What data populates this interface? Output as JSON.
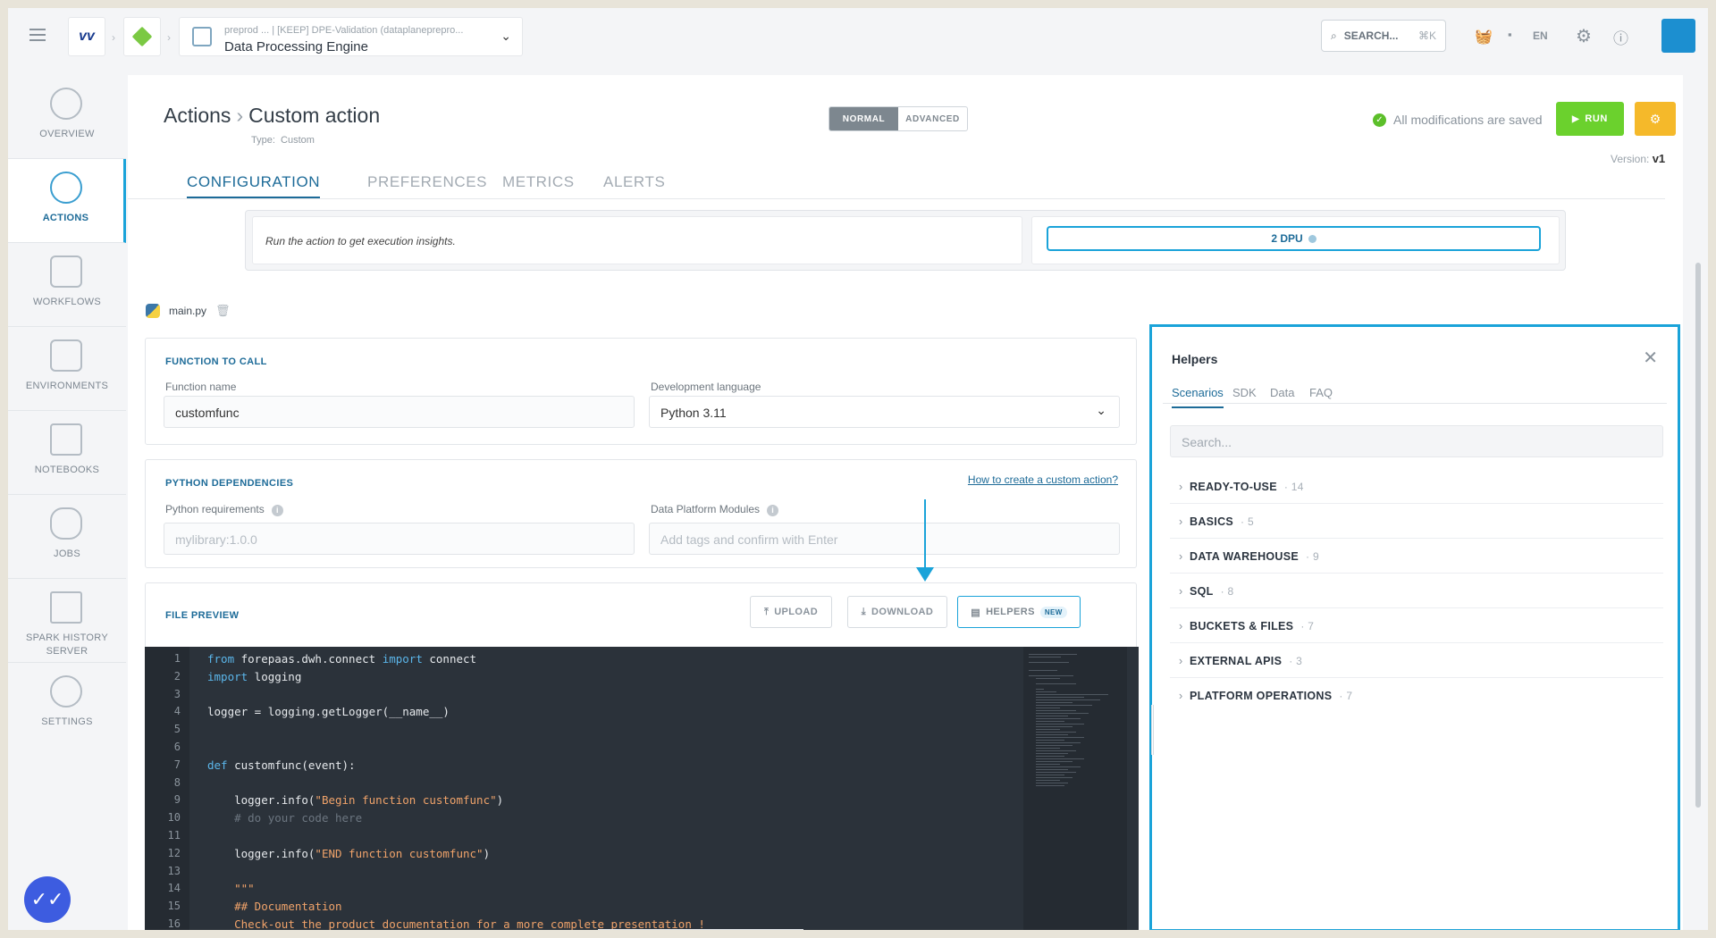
{
  "topbar": {
    "project_subtitle": "preprod ...   | [KEEP] DPE-Validation (dataplanepreprо...",
    "project_title": "Data Processing Engine",
    "search_label": "SEARCH...",
    "search_shortcut": "⌘K",
    "language": "EN"
  },
  "sidebar": {
    "items": [
      {
        "label": "OVERVIEW",
        "icon": "overview-icon"
      },
      {
        "label": "ACTIONS",
        "icon": "actions-icon"
      },
      {
        "label": "WORKFLOWS",
        "icon": "workflows-icon"
      },
      {
        "label": "ENVIRONMENTS",
        "icon": "environments-icon"
      },
      {
        "label": "NOTEBOOKS",
        "icon": "notebooks-icon"
      },
      {
        "label": "JOBS",
        "icon": "jobs-icon"
      },
      {
        "label": "SPARK HISTORY SERVER",
        "icon": "spark-history-icon"
      },
      {
        "label": "SETTINGS",
        "icon": "settings-icon"
      }
    ]
  },
  "header": {
    "breadcrumb_parent": "Actions",
    "breadcrumb_current": "Custom action",
    "type_label": "Type:",
    "type_value": "Custom",
    "mode_normal": "NORMAL",
    "mode_advanced": "ADVANCED",
    "saved_status": "All modifications are saved",
    "run_label": "RUN",
    "version_label": "Version:",
    "version_value": "v1"
  },
  "tabs": [
    "CONFIGURATION",
    "PREFERENCES",
    "METRICS",
    "ALERTS"
  ],
  "insight": {
    "message": "Run the action to get execution insights.",
    "dpu": "2 DPU"
  },
  "file": {
    "name": "main.py"
  },
  "function_card": {
    "title": "FUNCTION TO CALL",
    "function_name_label": "Function name",
    "function_name_value": "customfunc",
    "language_label": "Development language",
    "language_value": "Python 3.11"
  },
  "deps_card": {
    "title": "PYTHON DEPENDENCIES",
    "help_link": "How to create a custom action?",
    "requirements_label": "Python requirements",
    "requirements_placeholder": "mylibrary:1.0.0",
    "modules_label": "Data Platform Modules",
    "modules_placeholder": "Add tags and confirm with Enter"
  },
  "preview_card": {
    "title": "FILE PREVIEW",
    "upload": "UPLOAD",
    "download": "DOWNLOAD",
    "helpers": "HELPERS",
    "new_tag": "NEW"
  },
  "code_lines": [
    "1",
    "2",
    "3",
    "4",
    "5",
    "6",
    "7",
    "8",
    "9",
    "10",
    "11",
    "12",
    "13",
    "14",
    "15",
    "16"
  ],
  "helpers_panel": {
    "title": "Helpers",
    "tabs": [
      "Scenarios",
      "SDK",
      "Data",
      "FAQ"
    ],
    "search_placeholder": "Search...",
    "items": [
      {
        "label": "READY-TO-USE",
        "count": "· 14"
      },
      {
        "label": "BASICS",
        "count": "· 5"
      },
      {
        "label": "DATA WAREHOUSE",
        "count": "· 9"
      },
      {
        "label": "SQL",
        "count": "· 8"
      },
      {
        "label": "BUCKETS & FILES",
        "count": "· 7"
      },
      {
        "label": "EXTERNAL APIS",
        "count": "· 3"
      },
      {
        "label": "PLATFORM OPERATIONS",
        "count": "· 7"
      }
    ]
  }
}
